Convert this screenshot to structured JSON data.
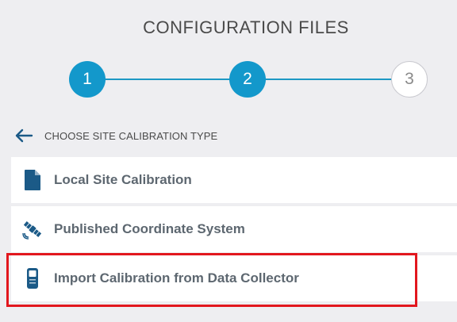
{
  "header": {
    "title": "CONFIGURATION FILES"
  },
  "stepper": {
    "steps": [
      {
        "label": "1",
        "state": "complete"
      },
      {
        "label": "2",
        "state": "active"
      },
      {
        "label": "3",
        "state": "pending"
      }
    ],
    "active_color": "#1398cb"
  },
  "back": {
    "icon": "arrow-left-icon",
    "label": "CHOOSE SITE CALIBRATION TYPE"
  },
  "options": [
    {
      "label": "Local Site Calibration",
      "icon": "file-icon",
      "highlighted": false
    },
    {
      "label": "Published Coordinate System",
      "icon": "satellite-icon",
      "highlighted": false
    },
    {
      "label": "Import Calibration from Data Collector",
      "icon": "data-collector-icon",
      "highlighted": true
    }
  ],
  "colors": {
    "background": "#eeeef1",
    "icon": "#1b5a87",
    "highlight_border": "#e2171e"
  }
}
